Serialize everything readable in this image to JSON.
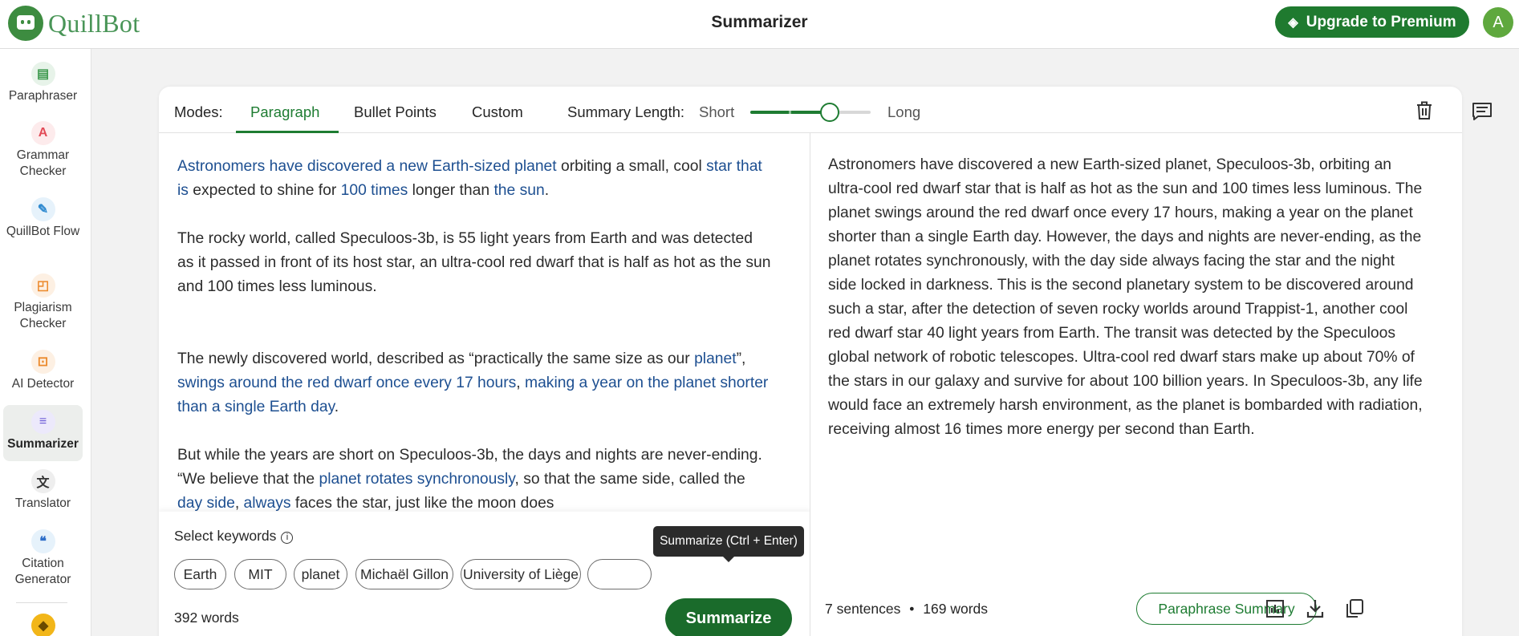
{
  "header": {
    "logo_text": "QuillBot",
    "page_title": "Summarizer",
    "upgrade_label": "Upgrade to Premium",
    "avatar_initial": "A"
  },
  "sidebar": {
    "items": [
      {
        "label": "Paraphraser",
        "icon": "paraphraser-icon"
      },
      {
        "label": "Grammar Checker",
        "icon": "grammar-checker-icon"
      },
      {
        "label": "QuillBot Flow",
        "icon": "quillbot-flow-icon"
      },
      {
        "label": "Plagiarism Checker",
        "icon": "plagiarism-checker-icon"
      },
      {
        "label": "AI Detector",
        "icon": "ai-detector-icon"
      },
      {
        "label": "Summarizer",
        "icon": "summarizer-icon",
        "active": true
      },
      {
        "label": "Translator",
        "icon": "translator-icon"
      },
      {
        "label": "Citation Generator",
        "icon": "citation-generator-icon"
      }
    ]
  },
  "toolbar": {
    "modes_label": "Modes:",
    "tabs": [
      {
        "label": "Paragraph",
        "active": true
      },
      {
        "label": "Bullet Points"
      },
      {
        "label": "Custom"
      }
    ],
    "summary_length_label": "Summary Length:",
    "short_label": "Short",
    "long_label": "Long",
    "summary_length_level": 0.66
  },
  "input": {
    "paragraphs": [
      [
        {
          "text": "Astronomers have discovered a new Earth-sized planet",
          "hl": true
        },
        {
          "text": " orbiting a small, cool "
        },
        {
          "text": "star that is",
          "hl": true
        },
        {
          "text": " expected to shine for "
        },
        {
          "text": "100 times",
          "hl": true
        },
        {
          "text": " longer than "
        },
        {
          "text": "the sun",
          "hl": true
        },
        {
          "text": "."
        }
      ],
      [
        {
          "text": "The rocky world, called Speculoos-3b, is 55 light years from Earth and was detected as it passed in front of its host star, an ultra-cool red dwarf that is half as hot as the sun and 100 times less luminous."
        }
      ],
      [
        {
          "text": "The newly discovered world, described as “practically the same size as our "
        },
        {
          "text": "planet",
          "hl": true
        },
        {
          "text": "”, "
        },
        {
          "text": "swings around the red dwarf once every 17 hours",
          "hl": true
        },
        {
          "text": ", "
        },
        {
          "text": "making a year on the planet shorter than a single Earth day",
          "hl": true
        },
        {
          "text": "."
        }
      ],
      [
        {
          "text": "But while the years are short on Speculoos-3b, the days and nights are never-ending. “We believe that the "
        },
        {
          "text": "planet rotates synchronously",
          "hl": true
        },
        {
          "text": ", so that the same side, called the "
        },
        {
          "text": "day side",
          "hl": true
        },
        {
          "text": ", "
        },
        {
          "text": "always",
          "hl": true
        },
        {
          "text": " faces the star, just like the moon does"
        }
      ]
    ],
    "keywords_title": "Select keywords",
    "keywords": [
      "Earth",
      "MIT",
      "planet",
      "Michaël Gillon",
      "University of Liège",
      ""
    ],
    "word_count": "392 words",
    "summarize_label": "Summarize",
    "tooltip": "Summarize (Ctrl + Enter)"
  },
  "output": {
    "summary": "Astronomers have discovered a new Earth-sized planet, Speculoos-3b, orbiting an ultra-cool red dwarf star that is half as hot as the sun and 100 times less luminous. The planet swings around the red dwarf once every 17 hours, making a year on the planet shorter than a single Earth day. However, the days and nights are never-ending, as the planet rotates synchronously, with the day side always facing the star and the night side locked in darkness. This is the second planetary system to be discovered around such a star, after the detection of seven rocky worlds around Trappist-1, another cool red dwarf star 40 light years from Earth. The transit was detected by the Speculoos global network of robotic telescopes. Ultra-cool red dwarf stars make up about 70% of the stars in our galaxy and survive for about 100 billion years. In Speculoos-3b, any life would face an extremely harsh environment, as the planet is bombarded with radiation, receiving almost 16 times more energy per second than Earth.",
    "sentences": "7 sentences",
    "separator": "•",
    "words": "169 words",
    "paraphrase_label": "Paraphrase Summary"
  },
  "colors": {
    "brand_green": "#1e7c32",
    "highlight_blue": "#1d4f91"
  }
}
